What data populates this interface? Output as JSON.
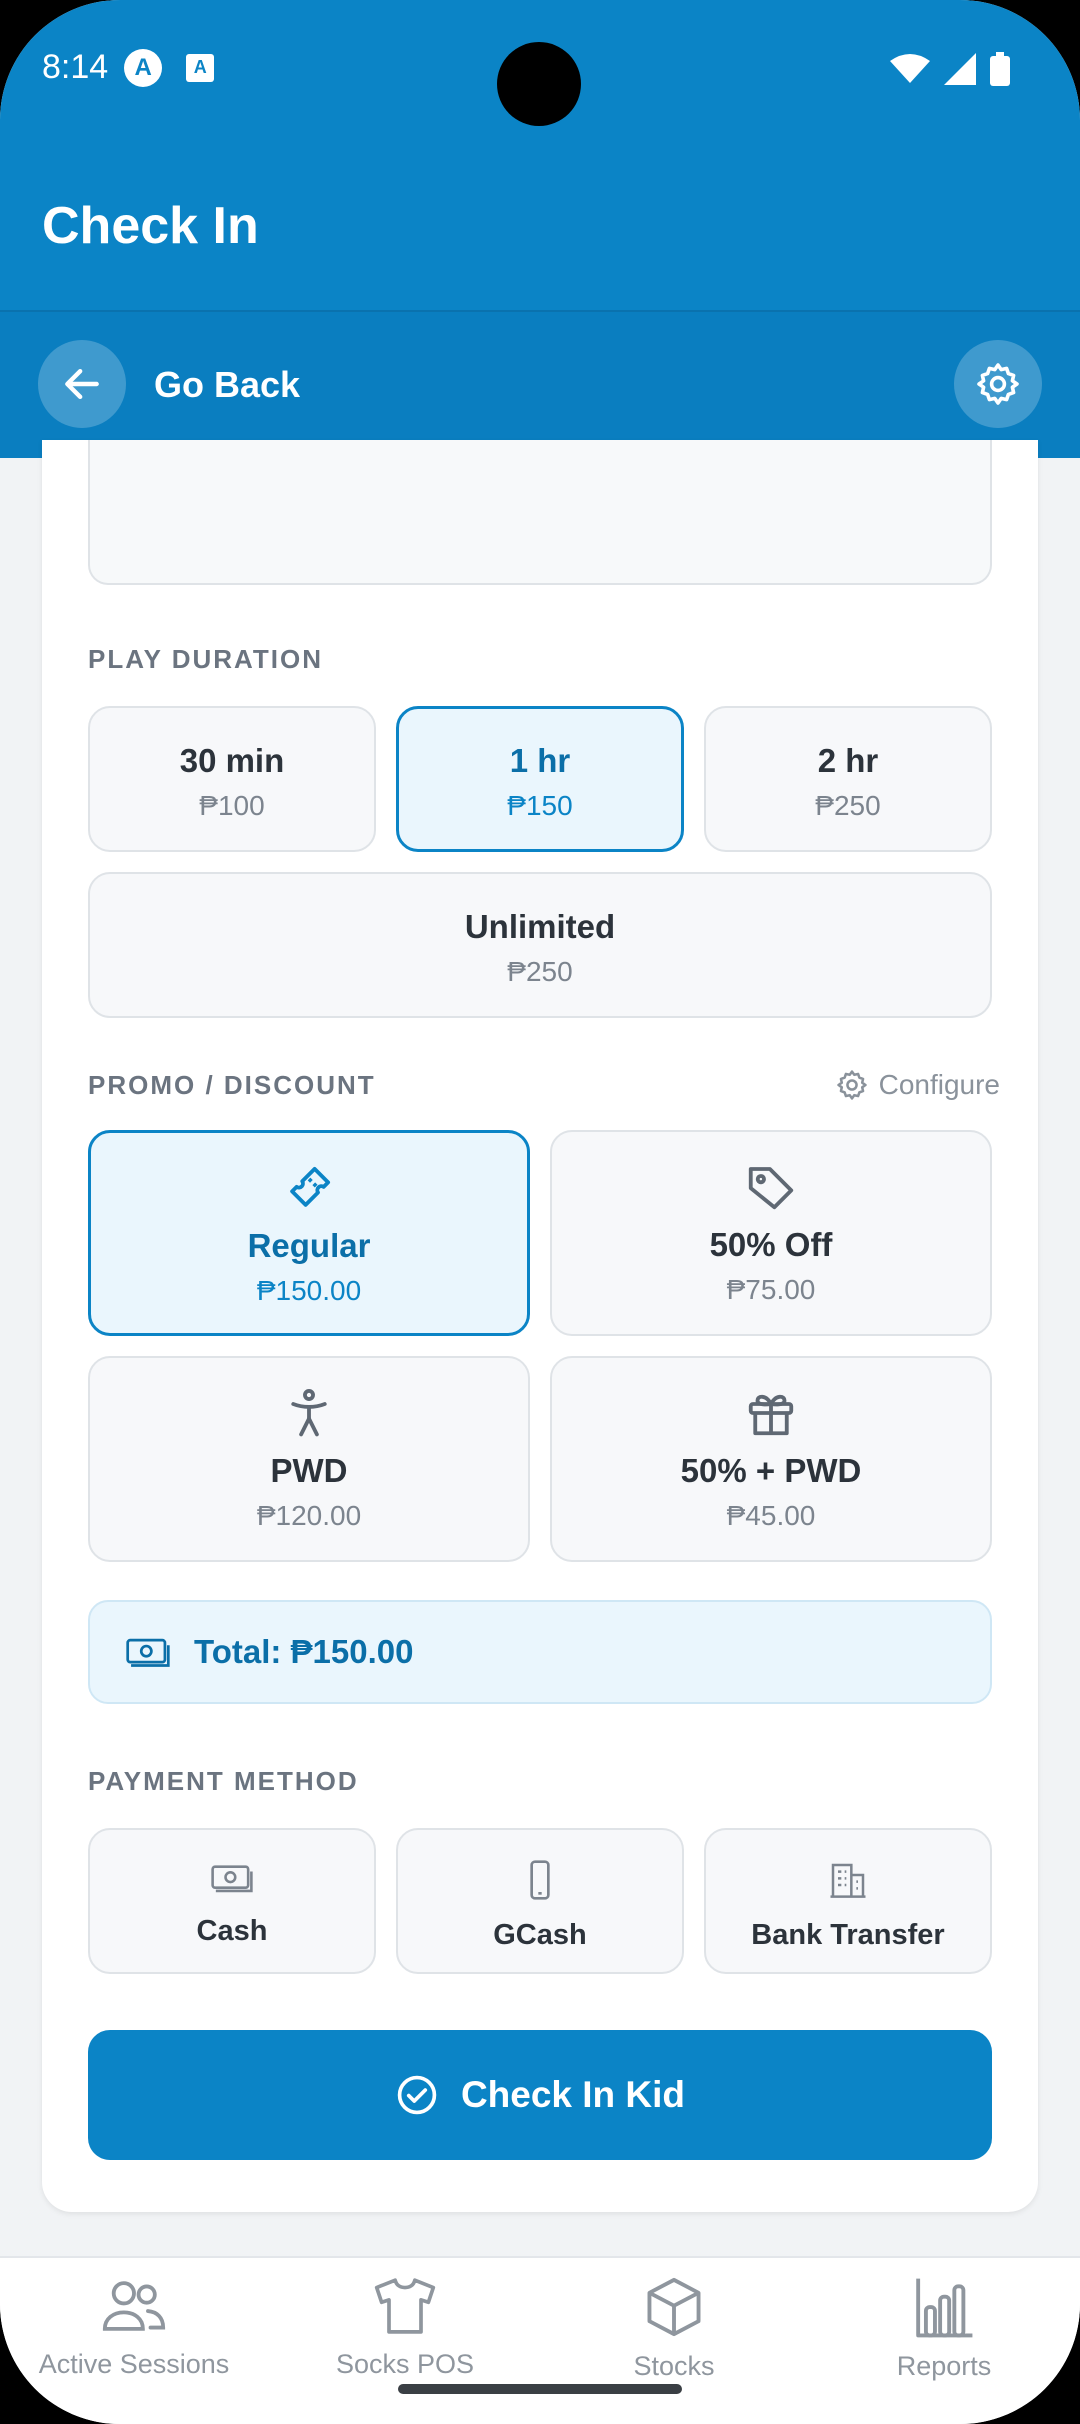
{
  "status_bar": {
    "time": "8:14",
    "icon_a": "A",
    "icon_b": "A"
  },
  "header": {
    "title": "Check In",
    "back_label": "Go Back"
  },
  "play_duration": {
    "label": "PLAY DURATION",
    "options": [
      {
        "name": "30 min",
        "price": "₱100",
        "selected": false
      },
      {
        "name": "1 hr",
        "price": "₱150",
        "selected": true
      },
      {
        "name": "2 hr",
        "price": "₱250",
        "selected": false
      },
      {
        "name": "Unlimited",
        "price": "₱250",
        "selected": false
      }
    ]
  },
  "promo": {
    "label": "PROMO / DISCOUNT",
    "configure_label": "Configure",
    "options": [
      {
        "name": "Regular",
        "price": "₱150.00",
        "icon": "ticket-icon",
        "selected": true
      },
      {
        "name": "50% Off",
        "price": "₱75.00",
        "icon": "tag-icon",
        "selected": false
      },
      {
        "name": "PWD",
        "price": "₱120.00",
        "icon": "accessibility-icon",
        "selected": false
      },
      {
        "name": "50% + PWD",
        "price": "₱45.00",
        "icon": "gift-icon",
        "selected": false
      }
    ]
  },
  "total": {
    "label": "Total: ₱150.00"
  },
  "payment": {
    "label": "PAYMENT METHOD",
    "options": [
      {
        "name": "Cash",
        "icon": "cash-icon"
      },
      {
        "name": "GCash",
        "icon": "phone-icon"
      },
      {
        "name": "Bank Transfer",
        "icon": "building-icon"
      }
    ]
  },
  "submit": {
    "label": "Check In Kid"
  },
  "nav": {
    "items": [
      {
        "label": "Active Sessions",
        "icon": "users-icon"
      },
      {
        "label": "Socks POS",
        "icon": "shirt-icon"
      },
      {
        "label": "Stocks",
        "icon": "box-icon"
      },
      {
        "label": "Reports",
        "icon": "bar-chart-icon"
      }
    ]
  },
  "colors": {
    "primary": "#0b84c6",
    "selected_bg": "#eaf6fd",
    "text_dark": "#2c333b",
    "text_muted": "#7c848e"
  }
}
